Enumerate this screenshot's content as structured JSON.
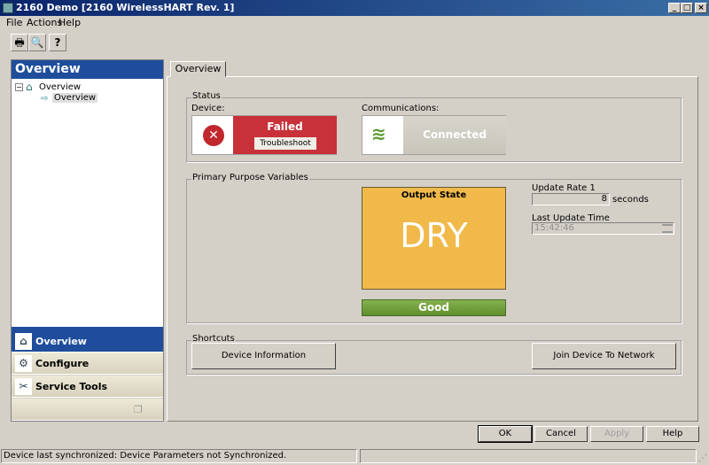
{
  "window": {
    "title": "2160 Demo [2160 WirelessHART Rev. 1]",
    "min": "_",
    "max": "□",
    "close": "×"
  },
  "menu": [
    "File",
    "Actions",
    "Help"
  ],
  "toolbar": {
    "print": "🖶",
    "preview": "🔍",
    "help": "?"
  },
  "left": {
    "header": "Overview",
    "tree": {
      "root": "Overview",
      "child": "Overview"
    },
    "nav": [
      {
        "label": "Overview",
        "icon": "home-icon"
      },
      {
        "label": "Configure",
        "icon": "gear-icon"
      },
      {
        "label": "Service Tools",
        "icon": "tools-icon"
      }
    ]
  },
  "tab": "Overview",
  "status": {
    "group": "Status",
    "device_label": "Device:",
    "device_state": "Failed",
    "troubleshoot": "Troubleshoot",
    "comm_label": "Communications:",
    "comm_state": "Connected"
  },
  "ppv": {
    "group": "Primary Purpose Variables",
    "output_title": "Output State",
    "output_value": "DRY",
    "quality": "Good",
    "update_rate_label": "Update Rate 1",
    "update_rate_value": "8",
    "update_rate_unit": "seconds",
    "last_update_label": "Last Update Time",
    "last_update_value": "15:42:46"
  },
  "shortcuts": {
    "group": "Shortcuts",
    "device_info": "Device Information",
    "join": "Join Device To Network"
  },
  "buttons": {
    "ok": "OK",
    "cancel": "Cancel",
    "apply": "Apply",
    "help": "Help"
  },
  "statusbar": "Device last synchronized: Device Parameters not Synchronized.",
  "colors": {
    "failed": "#c8313a",
    "output": "#f0b94a",
    "good": "#6a9a3a",
    "blue": "#1f4d9c"
  }
}
